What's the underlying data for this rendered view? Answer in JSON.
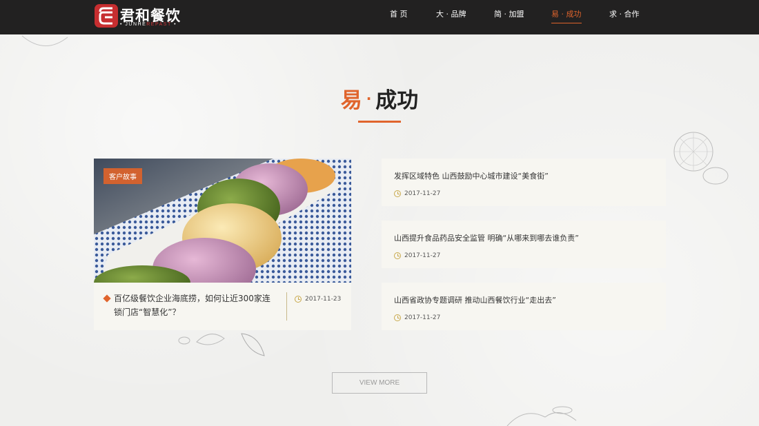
{
  "header": {
    "logo_text": "君和餐饮",
    "logo_sub_white": "JUNHE",
    "logo_sub_red": "REPAST",
    "nav": [
      {
        "label": "首 页",
        "active": false
      },
      {
        "label": "大 · 品牌",
        "active": false
      },
      {
        "label": "简 · 加盟",
        "active": false
      },
      {
        "label": "易 · 成功",
        "active": true
      },
      {
        "label": "求 · 合作",
        "active": false
      }
    ]
  },
  "section": {
    "title_accent": "易",
    "title_dot": "·",
    "title_rest": "成功"
  },
  "feature": {
    "badge": "客户故事",
    "title": "百亿级餐饮企业海底捞，如何让近300家连锁门店“智慧化”？",
    "date": "2017-11-23"
  },
  "news": [
    {
      "title": "发挥区域特色 山西鼓励中心城市建设“美食街”",
      "date": "2017-11-27"
    },
    {
      "title": "山西提升食品药品安全监管 明确“从哪来到哪去谁负责”",
      "date": "2017-11-27"
    },
    {
      "title": "山西省政协专题调研 推动山西餐饮行业“走出去”",
      "date": "2017-11-27"
    }
  ],
  "view_more": "VIEW MORE",
  "colors": {
    "accent": "#e0642c",
    "header_bg": "#222121",
    "card_bg": "#f7f6f1"
  }
}
